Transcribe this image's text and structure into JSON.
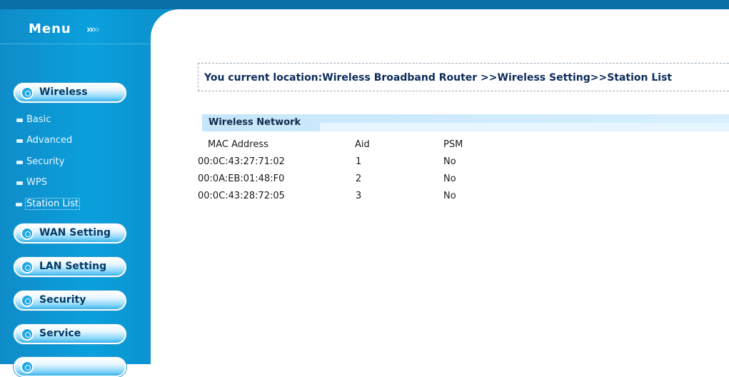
{
  "sidebar": {
    "title": "Menu",
    "arrows": [
      "›",
      "›",
      "›",
      "›"
    ],
    "sections": [
      {
        "label": "Wireless"
      },
      {
        "label": "WAN Setting"
      },
      {
        "label": "LAN Setting"
      },
      {
        "label": "Security"
      },
      {
        "label": "Service"
      }
    ],
    "wireless_items": [
      {
        "label": "Basic"
      },
      {
        "label": "Advanced"
      },
      {
        "label": "Security"
      },
      {
        "label": "WPS"
      },
      {
        "label": "Station List",
        "active": true
      }
    ]
  },
  "location": {
    "text": "You current location:Wireless Broadband Router >>Wireless Setting>>Station List"
  },
  "section": {
    "title": "Wireless Network"
  },
  "table": {
    "headers": [
      "MAC Address",
      "Aid",
      "PSM"
    ],
    "rows": [
      [
        "00:0C:43:27:71:02",
        "1",
        "No"
      ],
      [
        "00:0A:EB:01:48:F0",
        "2",
        "No"
      ],
      [
        "00:0C:43:28:72:05",
        "3",
        "No"
      ]
    ]
  },
  "colors": {
    "sidebar_blue": "#0b93cf",
    "top_bar": "#0a6ea7",
    "header_band": "#c5e6fb"
  }
}
